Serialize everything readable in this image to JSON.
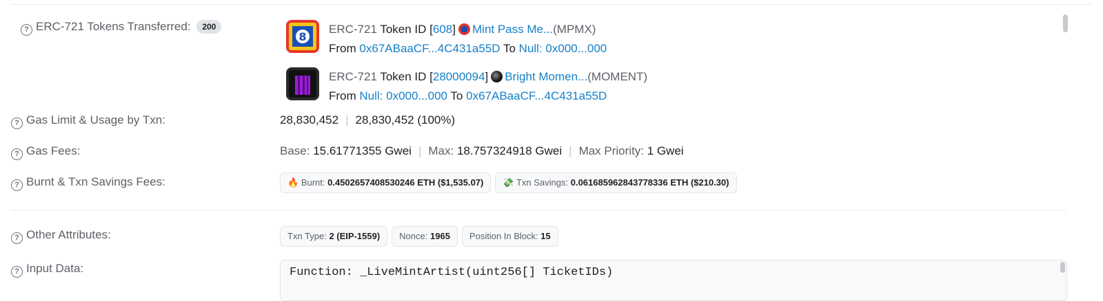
{
  "tokens_transferred": {
    "label": "ERC-721 Tokens Transferred:",
    "count": "200",
    "items": [
      {
        "standard": "ERC-721",
        "token_id_label": "Token ID [",
        "token_id": "608",
        "token_id_close": "]",
        "name": "Mint Pass Me...",
        "symbol": "(MPMX)",
        "from_label": "From",
        "from": "0x67ABaaCF...4C431a55D",
        "to_label": "To",
        "to": "Null: 0x000...000",
        "icon": "mint-pass-icon",
        "icon_color": "#e8342a"
      },
      {
        "standard": "ERC-721",
        "token_id_label": "Token ID [",
        "token_id": "28000094",
        "token_id_close": "]",
        "name": "Bright Momen...",
        "symbol": "(MOMENT)",
        "from_label": "From",
        "from": "Null: 0x000...000",
        "to_label": "To",
        "to": "0x67ABaaCF...4C431a55D",
        "icon": "bright-moments-icon",
        "icon_color": "#9b1fd1"
      }
    ]
  },
  "gas_limit": {
    "label": "Gas Limit & Usage by Txn:",
    "limit": "28,830,452",
    "usage": "28,830,452 (100%)"
  },
  "gas_fees": {
    "label": "Gas Fees:",
    "base_label": "Base:",
    "base": "15.61771355 Gwei",
    "max_label": "Max:",
    "max": "18.757324918 Gwei",
    "priority_label": "Max Priority:",
    "priority": "1 Gwei"
  },
  "burnt_fees": {
    "label": "Burnt & Txn Savings Fees:",
    "burnt_label": "Burnt:",
    "burnt": "0.4502657408530246 ETH ($1,535.07)",
    "savings_label": "Txn Savings:",
    "savings": "0.061685962843778336 ETH ($210.30)"
  },
  "other_attributes": {
    "label": "Other Attributes:",
    "txn_type_label": "Txn Type:",
    "txn_type": "2 (EIP-1559)",
    "nonce_label": "Nonce:",
    "nonce": "1965",
    "position_label": "Position In Block:",
    "position": "15"
  },
  "input_data": {
    "label": "Input Data:",
    "function": "Function: _LiveMintArtist(uint256[] TicketIDs)"
  },
  "colors": {
    "link": "#1680c9",
    "label": "#5c6066"
  }
}
